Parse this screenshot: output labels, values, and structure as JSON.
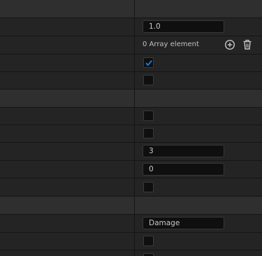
{
  "details_panel": {
    "float_value": "1.0",
    "array_label": "0 Array element",
    "add_element_icon": "plus-circle-icon",
    "delete_all_icon": "trash-icon",
    "checkbox_1_checked": true,
    "checkbox_2_checked": false,
    "checkbox_3_checked": false,
    "checkbox_4_checked": false,
    "int_value_1": "3",
    "int_value_2": "0",
    "checkbox_5_checked": false,
    "name_value": "Damage",
    "checkbox_6_checked": false,
    "accent_color": "#1a79d4"
  }
}
